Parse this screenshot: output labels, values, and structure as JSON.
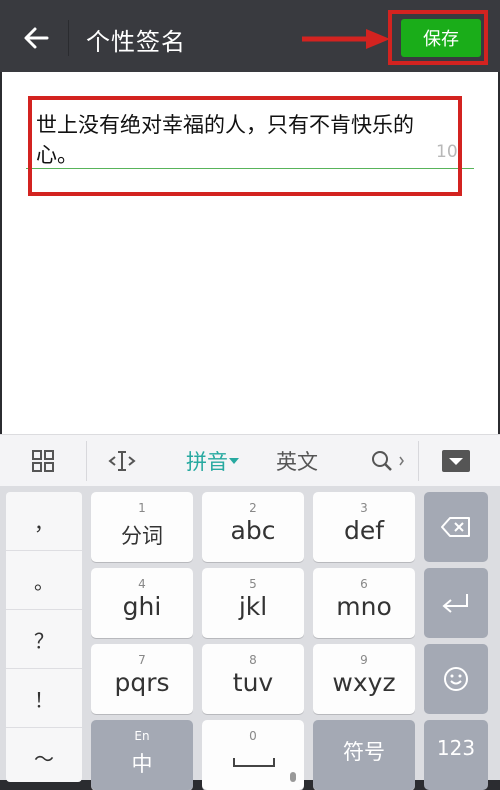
{
  "header": {
    "back_icon": "arrow-left-icon",
    "title": "个性签名",
    "save_label": "保存"
  },
  "content": {
    "signature_text": "世上没有绝对幸福的人，只有不肯快乐的心。",
    "remaining_count": "10"
  },
  "keyboard_toolbar": {
    "grid_icon": "grid-icon",
    "cursor_icon": "cursor-move-icon",
    "pinyin_label": "拼音",
    "english_label": "英文",
    "search_icon": "search-icon",
    "hide_icon": "hide-keyboard-icon"
  },
  "keyboard": {
    "side_keys": [
      "，",
      "。",
      "？",
      "！",
      "～"
    ],
    "keys": [
      {
        "num": "1",
        "label": "分词"
      },
      {
        "num": "2",
        "label": "abc"
      },
      {
        "num": "3",
        "label": "def"
      },
      {
        "num": "4",
        "label": "ghi"
      },
      {
        "num": "5",
        "label": "jkl"
      },
      {
        "num": "6",
        "label": "mno"
      },
      {
        "num": "7",
        "label": "pqrs"
      },
      {
        "num": "8",
        "label": "tuv"
      },
      {
        "num": "9",
        "label": "wxyz"
      }
    ],
    "bottom": {
      "lang_top": "En",
      "lang_main": "中",
      "space_num": "0",
      "symbol_label": "符号",
      "num_label": "123"
    }
  },
  "colors": {
    "accent": "#1aad19",
    "highlight": "#d32320",
    "teal": "#27a9a0"
  }
}
